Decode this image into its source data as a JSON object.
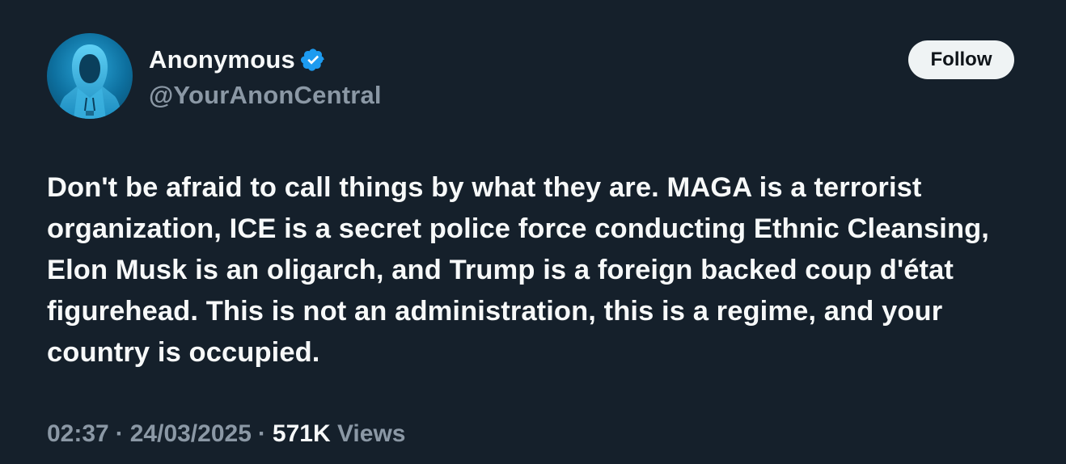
{
  "author": {
    "display_name": "Anonymous",
    "handle": "@YourAnonCentral",
    "verified": true,
    "avatar_icon": "hooded-figure-avatar",
    "verified_icon": "verified-badge-icon",
    "verified_color": "#1d9bf0"
  },
  "actions": {
    "follow_label": "Follow"
  },
  "tweet": {
    "text": "Don't be afraid to call things by what they are. MAGA is a terrorist organization, ICE is a secret police force conducting Ethnic Cleansing, Elon Musk is an oligarch, and Trump is a foreign backed coup d'état figurehead. This is not an administration, this is a regime, and your country is occupied."
  },
  "meta": {
    "time": "02:37",
    "separator": "·",
    "date": "24/03/2025",
    "views_count": "571K",
    "views_label": "Views"
  },
  "colors": {
    "background": "#15202b",
    "primary_text": "#f7f9f9",
    "secondary_text": "#8b98a5",
    "follow_button_bg": "#eff3f4"
  }
}
